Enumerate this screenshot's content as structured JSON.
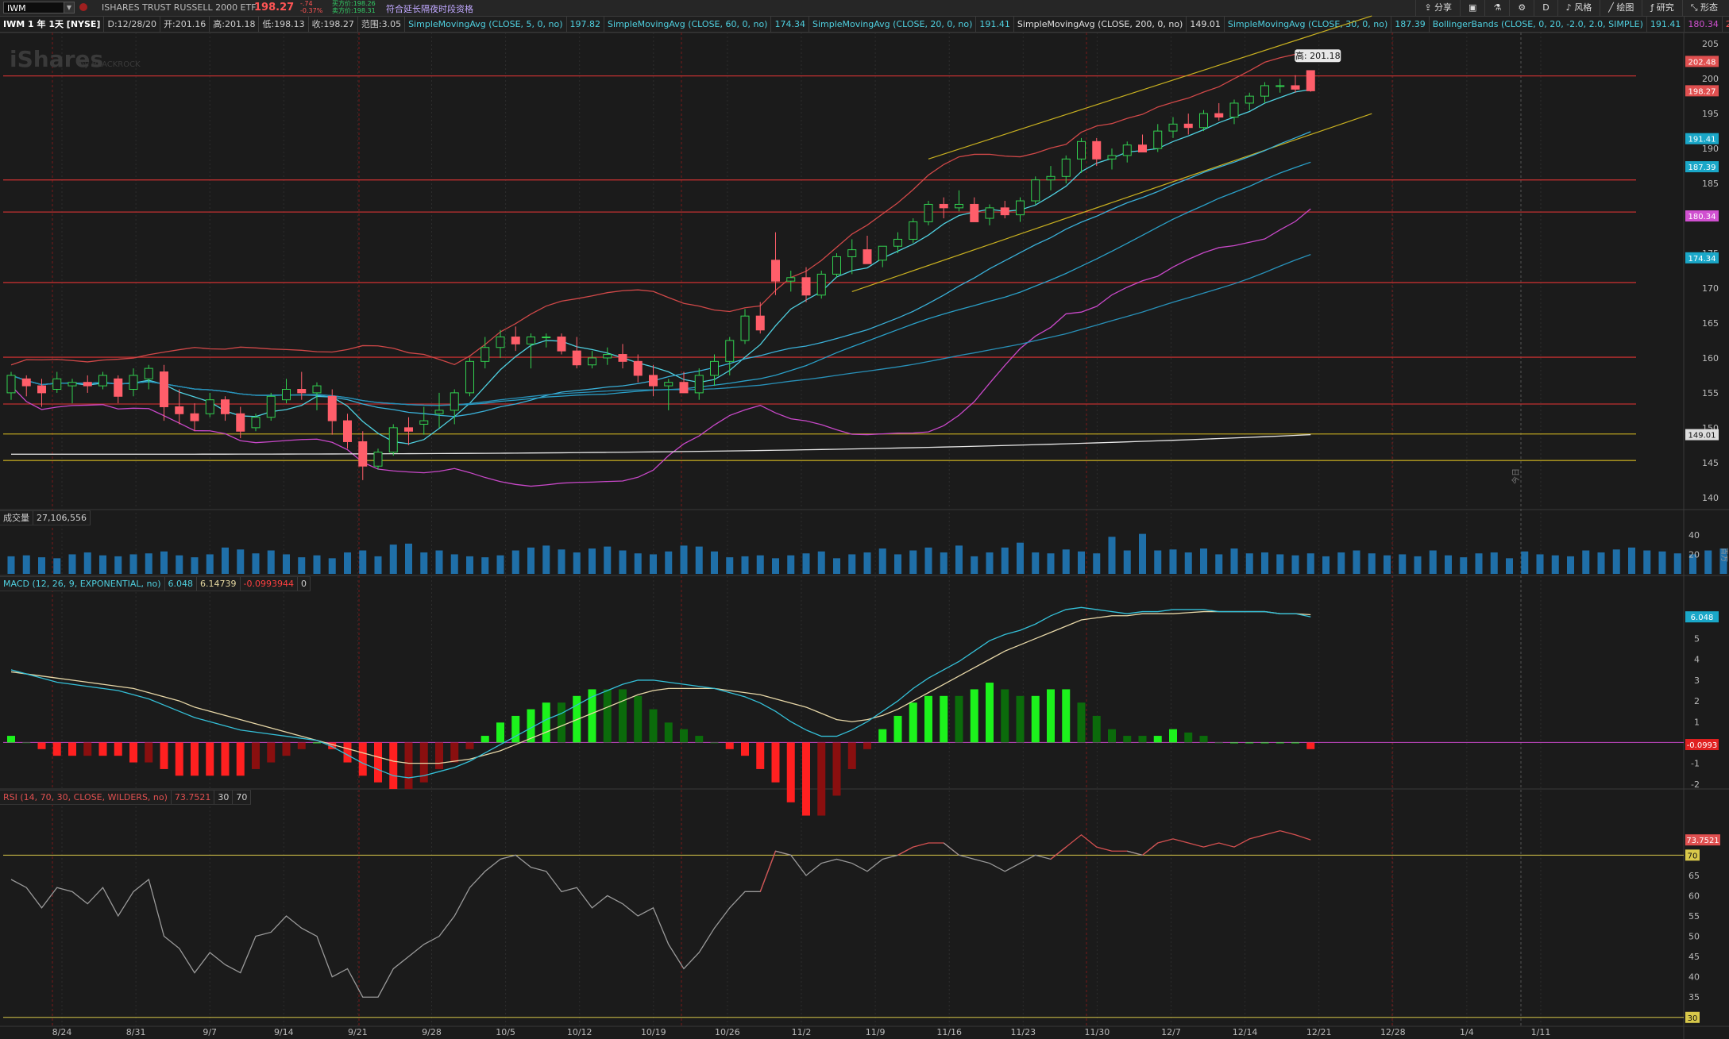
{
  "symbol_input": "IWM",
  "header": {
    "description": "ISHARES TRUST RUSSELL 2000 ETF",
    "last_price": "198.27",
    "change": "-.74",
    "change_pct": "-0.37%",
    "bid": "买方价:198.26",
    "ask": "卖方价:198.31",
    "extended_hours": "符合延长隔夜时段资格"
  },
  "toolbar": {
    "share": "分享",
    "timeframe": "D",
    "style": "风格",
    "draw": "绘图",
    "research": "研究",
    "pattern": "形态"
  },
  "titlebar": {
    "chart_title": "IWM 1 年 1天 [NYSE]",
    "date": "D:12/28/20",
    "open": "开:201.16",
    "high": "高:201.18",
    "low": "低:198.13",
    "close": "收:198.27",
    "range": "范围:3.05",
    "studies": [
      {
        "label": "SimpleMovingAvg (CLOSE, 5, 0, no)",
        "value": "197.82",
        "color": "#4fd0e0"
      },
      {
        "label": "SimpleMovingAvg (CLOSE, 60, 0, no)",
        "value": "174.34",
        "color": "#4fd0e0"
      },
      {
        "label": "SimpleMovingAvg (CLOSE, 20, 0, no)",
        "value": "191.41",
        "color": "#4fd0e0"
      },
      {
        "label": "SimpleMovingAvg (CLOSE, 200, 0, no)",
        "value": "149.01",
        "color": "#e0e0e0"
      },
      {
        "label": "SimpleMovingAvg (CLOSE, 30, 0, no)",
        "value": "187.39",
        "color": "#4fd0e0"
      },
      {
        "label": "BollingerBands (CLOSE, 0, 20, -2.0, 2.0, SIMPLE)",
        "value": "191.41",
        "value2": "180.34",
        "value3": "202.48",
        "color": "#4fd0e0"
      }
    ]
  },
  "watermark": {
    "brand": "iShares",
    "by": "by BLACKROCK"
  },
  "price_axis": {
    "ticks": [
      "205",
      "200",
      "195",
      "190",
      "185",
      "180",
      "175",
      "170",
      "165",
      "160",
      "155",
      "150",
      "145",
      "140"
    ],
    "labels": [
      {
        "text": "202.48",
        "color": "#e05050"
      },
      {
        "text": "198.27",
        "color": "#e05050"
      },
      {
        "text": "191.41",
        "color": "#1aa7c8"
      },
      {
        "text": "187.39",
        "color": "#1aa7c8"
      },
      {
        "text": "180.34",
        "color": "#d050d0"
      },
      {
        "text": "174.34",
        "color": "#1aa7c8"
      },
      {
        "text": "149.01",
        "color": "#dddddd"
      }
    ],
    "high_bubble": "高: 201.18",
    "right_edge_label": "今日"
  },
  "volume": {
    "label": "成交量",
    "value": "27,106,556",
    "ticks": [
      "40",
      "20"
    ],
    "unit": "百万",
    "values": [
      18,
      19,
      17,
      16,
      20,
      22,
      19,
      18,
      20,
      21,
      23,
      19,
      17,
      20,
      27,
      25,
      21,
      24,
      20,
      17,
      19,
      16,
      22,
      24,
      18,
      30,
      31,
      22,
      24,
      20,
      18,
      17,
      19,
      24,
      27,
      29,
      25,
      22,
      26,
      28,
      24,
      21,
      20,
      23,
      29,
      28,
      23,
      17,
      18,
      19,
      16,
      19,
      21,
      23,
      16,
      20,
      22,
      26,
      20,
      24,
      27,
      22,
      29,
      18,
      22,
      27,
      32,
      22,
      21,
      25,
      23,
      21,
      38,
      24,
      41,
      24,
      25,
      22,
      26,
      20,
      26,
      21,
      22,
      20,
      19,
      21,
      18,
      22,
      24,
      21,
      19,
      20,
      18,
      24,
      19,
      17,
      21,
      22,
      16,
      23,
      20,
      19,
      18,
      24,
      22,
      25,
      27,
      24,
      23,
      21,
      20,
      24,
      26,
      21,
      19,
      22,
      20,
      18,
      16,
      21,
      28,
      27,
      28,
      23,
      21,
      22,
      26,
      18,
      27,
      25,
      24,
      20,
      22,
      18,
      16,
      27
    ]
  },
  "macd": {
    "label": "MACD (12, 26, 9, EXPONENTIAL, no)",
    "value": "6.048",
    "avg": "6.14739",
    "diff": "-0.0993944",
    "zero": "0",
    "ticks": [
      "6",
      "5",
      "4",
      "3",
      "2",
      "1",
      "0",
      "-1",
      "-2"
    ],
    "labels": [
      {
        "text": "6.048",
        "color": "#1aa7c8"
      },
      {
        "text": "-0.0993",
        "color": "#e02020"
      }
    ]
  },
  "rsi": {
    "label": "RSI (14, 70, 30, CLOSE, WILDERS, no)",
    "value": "73.7521",
    "ob": "30",
    "os": "70",
    "ticks": [
      "65",
      "60",
      "55",
      "50",
      "45",
      "40",
      "35"
    ],
    "labels": [
      {
        "text": "73.7521",
        "color": "#e05050"
      },
      {
        "text": "70",
        "color": "#d8c84a"
      },
      {
        "text": "30",
        "color": "#d8c84a"
      }
    ]
  },
  "date_axis": [
    "8/24",
    "8/31",
    "9/7",
    "9/14",
    "9/21",
    "9/28",
    "10/5",
    "10/12",
    "10/19",
    "10/26",
    "11/2",
    "11/9",
    "11/16",
    "11/23",
    "11/30",
    "12/7",
    "12/14",
    "12/21",
    "12/28",
    "1/4",
    "1/11"
  ],
  "chart_data": {
    "type": "candlestick",
    "ohlc": [
      [
        155,
        158,
        154,
        157.5
      ],
      [
        157,
        157.5,
        154.5,
        156
      ],
      [
        156,
        157,
        153,
        155
      ],
      [
        155.5,
        158,
        155,
        157
      ],
      [
        156,
        157,
        153.5,
        156.5
      ],
      [
        156.5,
        157.5,
        155,
        156
      ],
      [
        156,
        158,
        155.5,
        157.5
      ],
      [
        157,
        157.5,
        153.5,
        154.5
      ],
      [
        155.5,
        158.5,
        154.5,
        157.5
      ],
      [
        157,
        159,
        155.5,
        158.5
      ],
      [
        158,
        159,
        151,
        153
      ],
      [
        153,
        155.5,
        150.5,
        152
      ],
      [
        152,
        153.5,
        149.5,
        151
      ],
      [
        152,
        155,
        151.5,
        154
      ],
      [
        154,
        154.5,
        151,
        152
      ],
      [
        152,
        153,
        148.5,
        149.5
      ],
      [
        150,
        152,
        149.5,
        151.5
      ],
      [
        151.5,
        155,
        151,
        154.5
      ],
      [
        154,
        157,
        153.5,
        155.5
      ],
      [
        155.5,
        158,
        154,
        155
      ],
      [
        155,
        156.5,
        152.5,
        156
      ],
      [
        154.5,
        155.5,
        149,
        151
      ],
      [
        151,
        152,
        147,
        148
      ],
      [
        148,
        149.5,
        142.5,
        144.5
      ],
      [
        144.5,
        147,
        144,
        146.5
      ],
      [
        146.5,
        150.5,
        146,
        150
      ],
      [
        150,
        151.5,
        147.5,
        149.5
      ],
      [
        150.5,
        153,
        149,
        151
      ],
      [
        152,
        155,
        150,
        152.5
      ],
      [
        152.5,
        155.5,
        150.5,
        155
      ],
      [
        155,
        160,
        154.5,
        159.5
      ],
      [
        159.5,
        163,
        158.5,
        161.5
      ],
      [
        161.5,
        164,
        160,
        163
      ],
      [
        163,
        164.5,
        161,
        162
      ],
      [
        162,
        163.5,
        158.5,
        163
      ],
      [
        163,
        163.5,
        161.5,
        163
      ],
      [
        163,
        163.5,
        160.5,
        161
      ],
      [
        161,
        163,
        158.5,
        159
      ],
      [
        159,
        161,
        158.5,
        160
      ],
      [
        160,
        161.5,
        159,
        160.5
      ],
      [
        160.5,
        162,
        158.5,
        159.5
      ],
      [
        159.5,
        160.5,
        156.5,
        157.5
      ],
      [
        157.5,
        159,
        154.5,
        156
      ],
      [
        156,
        157,
        152.5,
        156.5
      ],
      [
        156.5,
        158,
        155,
        155
      ],
      [
        155,
        158.5,
        154,
        157.5
      ],
      [
        157.5,
        160.5,
        156,
        159.5
      ],
      [
        159.5,
        163,
        157.5,
        162.5
      ],
      [
        162.5,
        167,
        162,
        166
      ],
      [
        166,
        168,
        163.5,
        164
      ],
      [
        174,
        178,
        169,
        171
      ],
      [
        171,
        172.5,
        169.5,
        171.5
      ],
      [
        171.5,
        173,
        168,
        169
      ],
      [
        169,
        172.5,
        168.5,
        172
      ],
      [
        172,
        175,
        171.5,
        174.5
      ],
      [
        174.5,
        177,
        172,
        175.5
      ],
      [
        175.5,
        177.5,
        173.5,
        173.5
      ],
      [
        174,
        176,
        173,
        176
      ],
      [
        176,
        178,
        175,
        177
      ],
      [
        177,
        180,
        176.5,
        179.5
      ],
      [
        179.5,
        182.5,
        179,
        182
      ],
      [
        182,
        183,
        180,
        181.5
      ],
      [
        181.5,
        184,
        181,
        182
      ],
      [
        182,
        183,
        179.5,
        179.5
      ],
      [
        180,
        182,
        179,
        181.5
      ],
      [
        181.5,
        182.5,
        180,
        180.5
      ],
      [
        180.5,
        183,
        179.5,
        182.5
      ],
      [
        182.5,
        186,
        182,
        185.5
      ],
      [
        185.5,
        187.5,
        184,
        186
      ],
      [
        186,
        189,
        185,
        188.5
      ],
      [
        188.5,
        191.5,
        186.5,
        191
      ],
      [
        191,
        191.5,
        187.5,
        188.5
      ],
      [
        188.5,
        190,
        187,
        189
      ],
      [
        189,
        191,
        188,
        190.5
      ],
      [
        190.5,
        192,
        189.5,
        189.5
      ],
      [
        190,
        193.5,
        189.5,
        192.5
      ],
      [
        192.5,
        194.5,
        191.5,
        193.5
      ],
      [
        193.5,
        195,
        192,
        193
      ],
      [
        193,
        195.5,
        192.5,
        195
      ],
      [
        195,
        196.5,
        194,
        194.5
      ],
      [
        194.5,
        197,
        193.5,
        196.5
      ],
      [
        196.5,
        198,
        195.5,
        197.5
      ],
      [
        197.5,
        199.5,
        196.5,
        199
      ],
      [
        199,
        200,
        198,
        199
      ],
      [
        199,
        200.5,
        198,
        198.5
      ],
      [
        201.16,
        201.18,
        198.13,
        198.27
      ]
    ],
    "hlines": [
      {
        "price": 170.8,
        "color": "#c03030"
      },
      {
        "price": 160.1,
        "color": "#c03030"
      },
      {
        "price": 153.4,
        "color": "#c03030"
      },
      {
        "price": 149.1,
        "color": "#b8a020"
      },
      {
        "price": 145.3,
        "color": "#b8a020"
      },
      {
        "price": 180.9,
        "color": "#c03030"
      },
      {
        "price": 185.5,
        "color": "#c03030"
      },
      {
        "price": 200.4,
        "color": "#c03030"
      }
    ],
    "macd_values": [
      3.5,
      3.3,
      3.1,
      2.9,
      2.8,
      2.7,
      2.6,
      2.5,
      2.3,
      2.1,
      1.8,
      1.5,
      1.2,
      1.0,
      0.8,
      0.6,
      0.5,
      0.4,
      0.3,
      0.2,
      0.1,
      -0.2,
      -0.6,
      -1.0,
      -1.3,
      -1.6,
      -1.7,
      -1.6,
      -1.4,
      -1.2,
      -0.9,
      -0.5,
      -0.1,
      0.3,
      0.7,
      1.1,
      1.4,
      1.8,
      2.2,
      2.5,
      2.8,
      3.0,
      3.0,
      2.9,
      2.8,
      2.7,
      2.6,
      2.4,
      2.2,
      1.9,
      1.5,
      1.0,
      0.6,
      0.3,
      0.3,
      0.6,
      1.0,
      1.5,
      2.0,
      2.6,
      3.1,
      3.5,
      3.9,
      4.4,
      4.9,
      5.2,
      5.4,
      5.7,
      6.1,
      6.4,
      6.5,
      6.4,
      6.3,
      6.2,
      6.3,
      6.3,
      6.4,
      6.4,
      6.4,
      6.3,
      6.3,
      6.3,
      6.3,
      6.2,
      6.2,
      6.05
    ],
    "macd_avg": [
      3.4,
      3.3,
      3.2,
      3.1,
      3.0,
      2.9,
      2.8,
      2.7,
      2.6,
      2.4,
      2.2,
      2.0,
      1.7,
      1.5,
      1.3,
      1.1,
      0.9,
      0.7,
      0.5,
      0.3,
      0.1,
      -0.1,
      -0.3,
      -0.5,
      -0.7,
      -0.9,
      -1.0,
      -1.0,
      -1.0,
      -0.9,
      -0.8,
      -0.6,
      -0.4,
      -0.1,
      0.2,
      0.5,
      0.8,
      1.1,
      1.4,
      1.7,
      2.0,
      2.3,
      2.5,
      2.6,
      2.6,
      2.6,
      2.6,
      2.5,
      2.4,
      2.3,
      2.1,
      1.9,
      1.7,
      1.4,
      1.1,
      1.0,
      1.1,
      1.3,
      1.6,
      2.0,
      2.4,
      2.8,
      3.2,
      3.6,
      4.0,
      4.4,
      4.7,
      5.0,
      5.3,
      5.6,
      5.9,
      6.0,
      6.1,
      6.1,
      6.2,
      6.2,
      6.2,
      6.25,
      6.3,
      6.3,
      6.3,
      6.3,
      6.3,
      6.2,
      6.2,
      6.15
    ],
    "rsi_values": [
      64,
      62,
      57,
      62,
      61,
      58,
      62,
      55,
      61,
      64,
      50,
      47,
      41,
      46,
      43,
      41,
      50,
      51,
      55,
      52,
      50,
      40,
      42,
      35,
      35,
      42,
      45,
      48,
      50,
      55,
      62,
      66,
      69,
      70,
      67,
      66,
      61,
      62,
      57,
      60,
      58,
      55,
      57,
      48,
      42,
      46,
      52,
      57,
      61,
      61,
      71,
      70,
      65,
      68,
      69,
      68,
      66,
      69,
      70,
      72,
      73,
      73,
      70,
      69,
      68,
      66,
      68,
      70,
      69,
      72,
      75,
      72,
      71,
      71,
      70,
      73,
      74,
      73,
      72,
      73,
      72,
      74,
      75,
      76,
      75,
      73.75
    ]
  }
}
